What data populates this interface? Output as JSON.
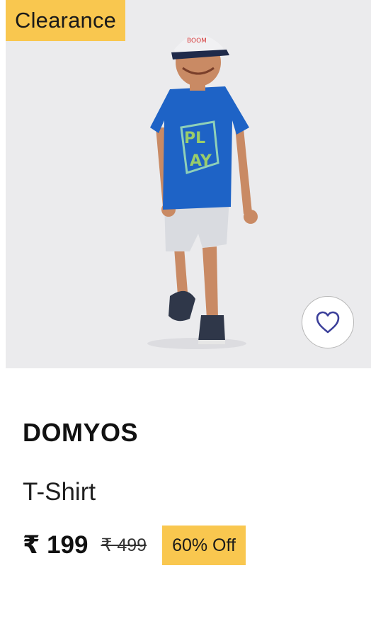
{
  "product": {
    "badge": "Clearance",
    "brand": "DOMYOS",
    "name": "T-Shirt",
    "price": "₹ 199",
    "mrp": "₹ 499",
    "discount": "60% Off",
    "image_alt": "Child wearing blue PLAY t-shirt, grey shorts and cap",
    "wishlist_icon": "heart-outline-icon",
    "colors": {
      "badge": "#f9c74f",
      "image_bg": "#ebebed",
      "shirt": "#1e63c6",
      "heart": "#3b3f9a"
    }
  }
}
